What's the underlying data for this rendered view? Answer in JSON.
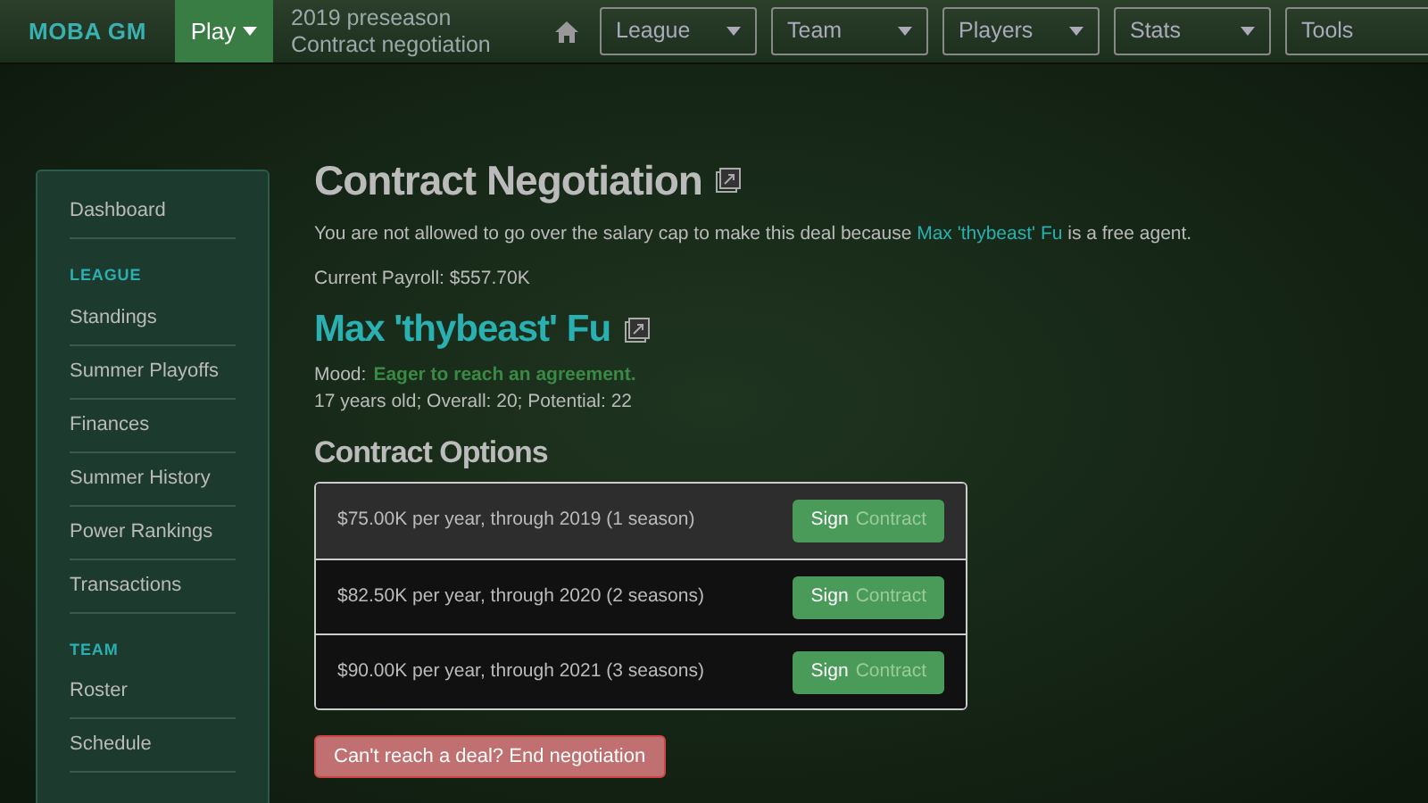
{
  "navbar": {
    "logo": "MOBA GM",
    "play_menu": {
      "label": "Play"
    },
    "season": "2019 preseason",
    "page": "Contract negotiation",
    "menus": [
      {
        "label": "League"
      },
      {
        "label": "Team"
      },
      {
        "label": "Players"
      },
      {
        "label": "Stats"
      },
      {
        "label": "Tools"
      }
    ]
  },
  "sidebar": {
    "items": [
      {
        "kind": "link",
        "label": "Dashboard"
      },
      {
        "kind": "header",
        "label": "LEAGUE"
      },
      {
        "kind": "link",
        "label": "Standings"
      },
      {
        "kind": "link",
        "label": "Summer Playoffs"
      },
      {
        "kind": "link",
        "label": "Finances"
      },
      {
        "kind": "link",
        "label": "Summer History"
      },
      {
        "kind": "link",
        "label": "Power Rankings"
      },
      {
        "kind": "link",
        "label": "Transactions"
      },
      {
        "kind": "header",
        "label": "TEAM"
      },
      {
        "kind": "link",
        "label": "Roster"
      },
      {
        "kind": "link",
        "label": "Schedule"
      }
    ]
  },
  "main": {
    "title": "Contract Negotiation",
    "notice": {
      "before": "You are not allowed to go over the salary cap to make this deal because ",
      "link": "Max 'thybeast' Fu",
      "after": " is a free agent."
    },
    "payroll": "Current Payroll: $557.70K",
    "player_name": "Max 'thybeast' Fu",
    "mood_label": "Mood:",
    "mood": "Eager to reach an agreement.",
    "bio": "17 years old; Overall: 20; Potential: 22",
    "options_title": "Contract Options",
    "options": [
      {
        "text": "$75.00K per year, through 2019 (1 season)",
        "selected": true,
        "button_main": "Sign",
        "button_rest": "Contract"
      },
      {
        "text": "$82.50K per year, through 2020 (2 seasons)",
        "selected": false,
        "button_main": "Sign",
        "button_rest": "Contract"
      },
      {
        "text": "$90.00K per year, through 2021 (3 seasons)",
        "selected": false,
        "button_main": "Sign",
        "button_rest": "Contract"
      }
    ],
    "end_button": "Can't reach a deal? End negotiation"
  }
}
